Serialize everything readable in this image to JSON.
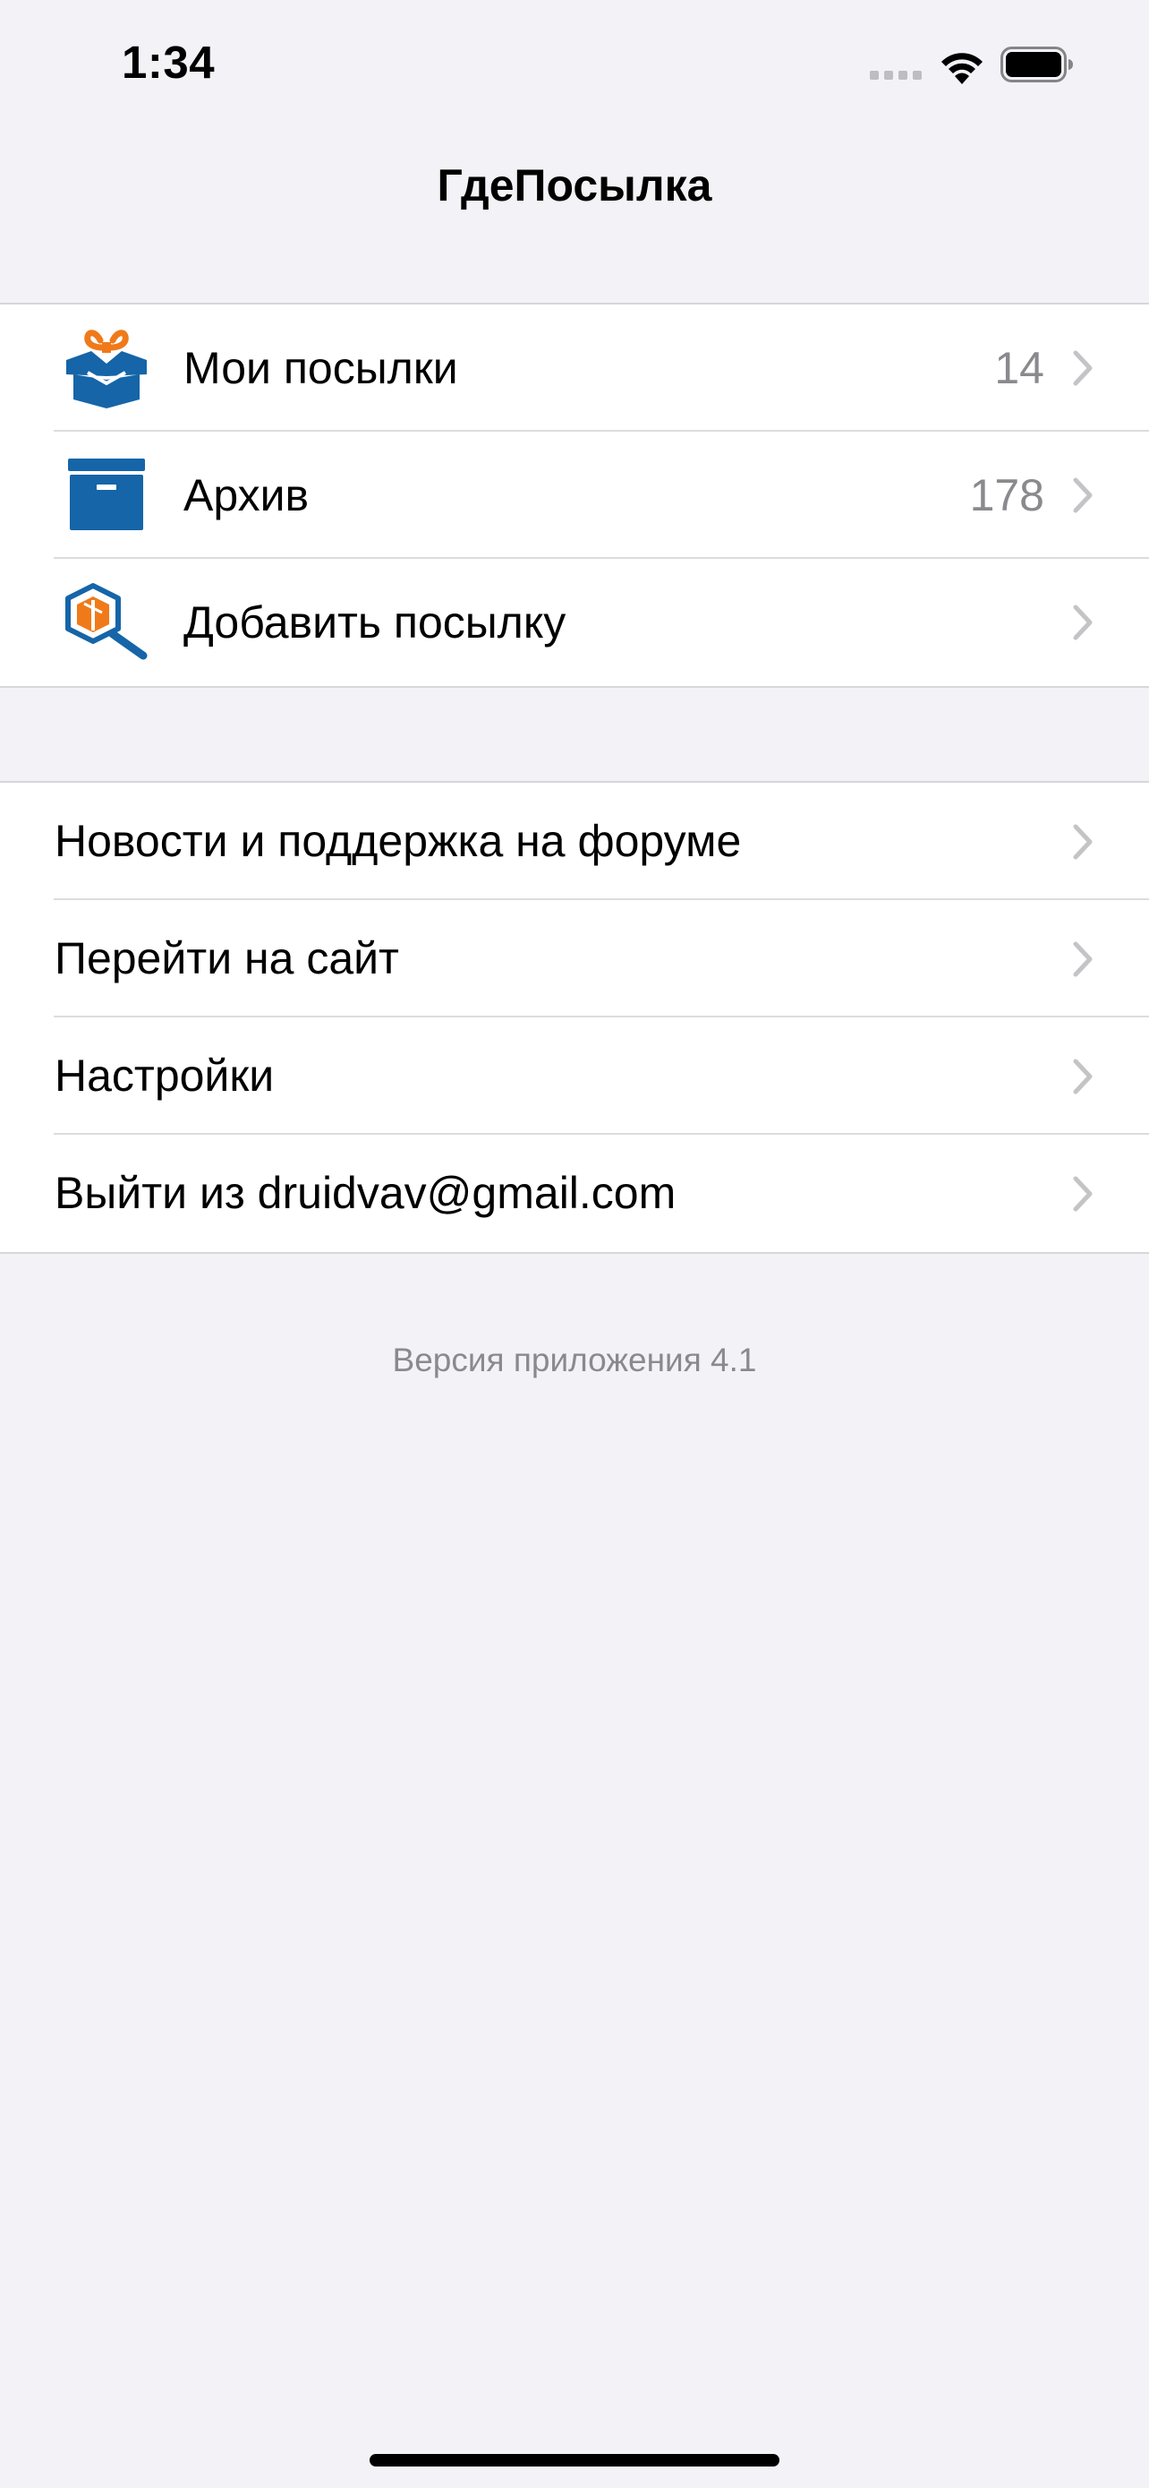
{
  "status_bar": {
    "time": "1:34",
    "icons": [
      "cellular-signal-icon",
      "wifi-icon",
      "battery-icon"
    ]
  },
  "nav": {
    "title": "ГдеПосылка"
  },
  "main_menu": [
    {
      "label": "Мои посылки",
      "count": "14",
      "icon": "open-box-icon"
    },
    {
      "label": "Архив",
      "count": "178",
      "icon": "archive-box-icon"
    },
    {
      "label": "Добавить посылку",
      "count": "",
      "icon": "package-search-icon"
    }
  ],
  "secondary_menu": [
    {
      "label": "Новости и поддержка на форуме"
    },
    {
      "label": "Перейти на сайт"
    },
    {
      "label": "Настройки"
    },
    {
      "label": "Выйти из druidvav@gmail.com"
    }
  ],
  "footer": {
    "version": "Версия приложения 4.1"
  },
  "colors": {
    "background": "#F2F2F7",
    "brand_blue": "#1565A8",
    "brand_orange": "#F07A1A",
    "secondary_text": "#8A8A8E",
    "chevron": "#C4C4C7"
  }
}
